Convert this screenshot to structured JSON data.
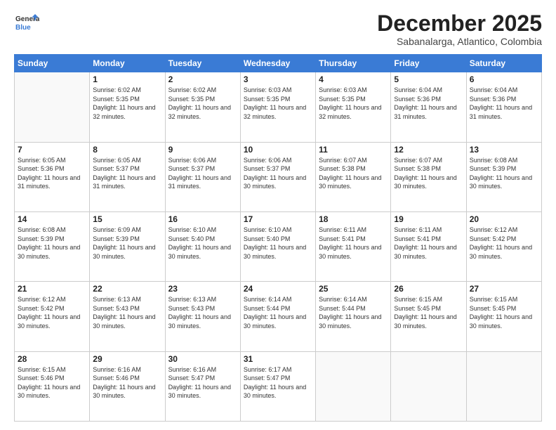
{
  "logo": {
    "line1": "General",
    "line2": "Blue"
  },
  "header": {
    "title": "December 2025",
    "subtitle": "Sabanalarga, Atlantico, Colombia"
  },
  "calendar": {
    "days_of_week": [
      "Sunday",
      "Monday",
      "Tuesday",
      "Wednesday",
      "Thursday",
      "Friday",
      "Saturday"
    ],
    "rows": [
      [
        {
          "day": "",
          "empty": true
        },
        {
          "day": "1",
          "sunrise": "6:02 AM",
          "sunset": "5:35 PM",
          "daylight": "11 hours and 32 minutes."
        },
        {
          "day": "2",
          "sunrise": "6:02 AM",
          "sunset": "5:35 PM",
          "daylight": "11 hours and 32 minutes."
        },
        {
          "day": "3",
          "sunrise": "6:03 AM",
          "sunset": "5:35 PM",
          "daylight": "11 hours and 32 minutes."
        },
        {
          "day": "4",
          "sunrise": "6:03 AM",
          "sunset": "5:35 PM",
          "daylight": "11 hours and 32 minutes."
        },
        {
          "day": "5",
          "sunrise": "6:04 AM",
          "sunset": "5:36 PM",
          "daylight": "11 hours and 31 minutes."
        },
        {
          "day": "6",
          "sunrise": "6:04 AM",
          "sunset": "5:36 PM",
          "daylight": "11 hours and 31 minutes."
        }
      ],
      [
        {
          "day": "7",
          "sunrise": "6:05 AM",
          "sunset": "5:36 PM",
          "daylight": "11 hours and 31 minutes."
        },
        {
          "day": "8",
          "sunrise": "6:05 AM",
          "sunset": "5:37 PM",
          "daylight": "11 hours and 31 minutes."
        },
        {
          "day": "9",
          "sunrise": "6:06 AM",
          "sunset": "5:37 PM",
          "daylight": "11 hours and 31 minutes."
        },
        {
          "day": "10",
          "sunrise": "6:06 AM",
          "sunset": "5:37 PM",
          "daylight": "11 hours and 30 minutes."
        },
        {
          "day": "11",
          "sunrise": "6:07 AM",
          "sunset": "5:38 PM",
          "daylight": "11 hours and 30 minutes."
        },
        {
          "day": "12",
          "sunrise": "6:07 AM",
          "sunset": "5:38 PM",
          "daylight": "11 hours and 30 minutes."
        },
        {
          "day": "13",
          "sunrise": "6:08 AM",
          "sunset": "5:39 PM",
          "daylight": "11 hours and 30 minutes."
        }
      ],
      [
        {
          "day": "14",
          "sunrise": "6:08 AM",
          "sunset": "5:39 PM",
          "daylight": "11 hours and 30 minutes."
        },
        {
          "day": "15",
          "sunrise": "6:09 AM",
          "sunset": "5:39 PM",
          "daylight": "11 hours and 30 minutes."
        },
        {
          "day": "16",
          "sunrise": "6:10 AM",
          "sunset": "5:40 PM",
          "daylight": "11 hours and 30 minutes."
        },
        {
          "day": "17",
          "sunrise": "6:10 AM",
          "sunset": "5:40 PM",
          "daylight": "11 hours and 30 minutes."
        },
        {
          "day": "18",
          "sunrise": "6:11 AM",
          "sunset": "5:41 PM",
          "daylight": "11 hours and 30 minutes."
        },
        {
          "day": "19",
          "sunrise": "6:11 AM",
          "sunset": "5:41 PM",
          "daylight": "11 hours and 30 minutes."
        },
        {
          "day": "20",
          "sunrise": "6:12 AM",
          "sunset": "5:42 PM",
          "daylight": "11 hours and 30 minutes."
        }
      ],
      [
        {
          "day": "21",
          "sunrise": "6:12 AM",
          "sunset": "5:42 PM",
          "daylight": "11 hours and 30 minutes."
        },
        {
          "day": "22",
          "sunrise": "6:13 AM",
          "sunset": "5:43 PM",
          "daylight": "11 hours and 30 minutes."
        },
        {
          "day": "23",
          "sunrise": "6:13 AM",
          "sunset": "5:43 PM",
          "daylight": "11 hours and 30 minutes."
        },
        {
          "day": "24",
          "sunrise": "6:14 AM",
          "sunset": "5:44 PM",
          "daylight": "11 hours and 30 minutes."
        },
        {
          "day": "25",
          "sunrise": "6:14 AM",
          "sunset": "5:44 PM",
          "daylight": "11 hours and 30 minutes."
        },
        {
          "day": "26",
          "sunrise": "6:15 AM",
          "sunset": "5:45 PM",
          "daylight": "11 hours and 30 minutes."
        },
        {
          "day": "27",
          "sunrise": "6:15 AM",
          "sunset": "5:45 PM",
          "daylight": "11 hours and 30 minutes."
        }
      ],
      [
        {
          "day": "28",
          "sunrise": "6:15 AM",
          "sunset": "5:46 PM",
          "daylight": "11 hours and 30 minutes."
        },
        {
          "day": "29",
          "sunrise": "6:16 AM",
          "sunset": "5:46 PM",
          "daylight": "11 hours and 30 minutes."
        },
        {
          "day": "30",
          "sunrise": "6:16 AM",
          "sunset": "5:47 PM",
          "daylight": "11 hours and 30 minutes."
        },
        {
          "day": "31",
          "sunrise": "6:17 AM",
          "sunset": "5:47 PM",
          "daylight": "11 hours and 30 minutes."
        },
        {
          "day": "",
          "empty": true
        },
        {
          "day": "",
          "empty": true
        },
        {
          "day": "",
          "empty": true
        }
      ]
    ]
  }
}
